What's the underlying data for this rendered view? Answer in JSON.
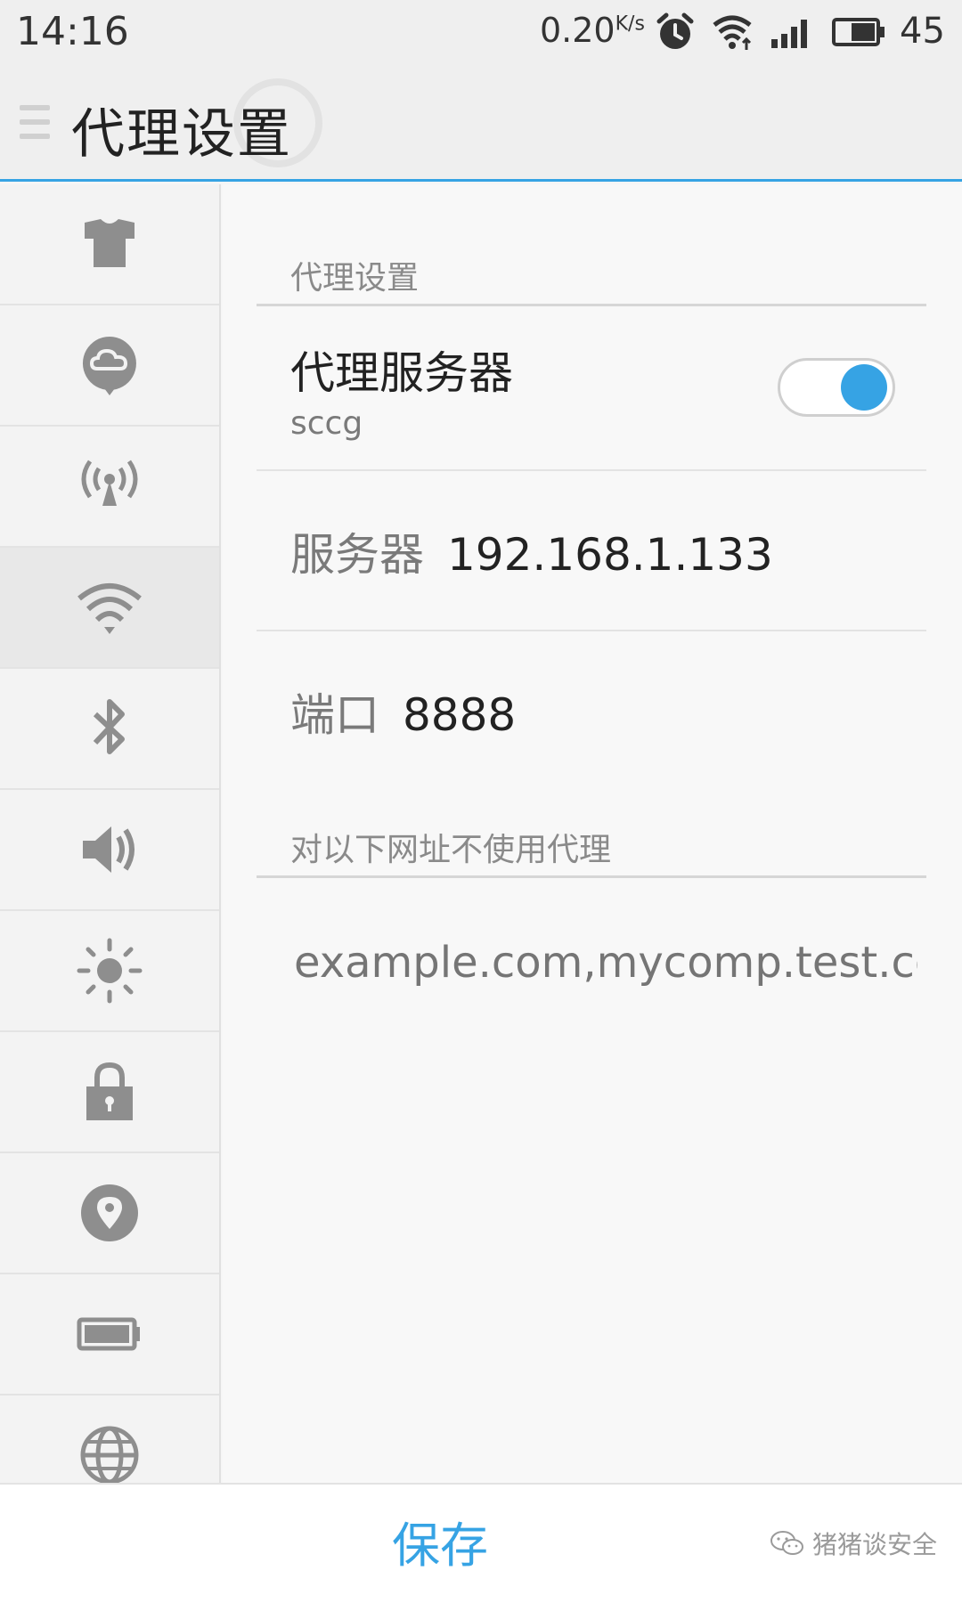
{
  "status_bar": {
    "time": "14:16",
    "speed_value": "0.20",
    "speed_unit": "K/s",
    "battery_level": "45"
  },
  "header": {
    "title": "代理设置",
    "menu_icon": "menu-icon"
  },
  "sidebar": {
    "items": [
      {
        "icon": "theme-shirt-icon",
        "active": false
      },
      {
        "icon": "cloud-bubble-icon",
        "active": false
      },
      {
        "icon": "hotspot-icon",
        "active": false
      },
      {
        "icon": "wifi-icon",
        "active": true
      },
      {
        "icon": "bluetooth-icon",
        "active": false
      },
      {
        "icon": "sound-icon",
        "active": false
      },
      {
        "icon": "brightness-icon",
        "active": false
      },
      {
        "icon": "lock-icon",
        "active": false
      },
      {
        "icon": "location-icon",
        "active": false
      },
      {
        "icon": "battery-icon",
        "active": false
      },
      {
        "icon": "globe-icon",
        "active": false
      }
    ]
  },
  "content": {
    "section_proxy": "代理设置",
    "proxy_server": {
      "title": "代理服务器",
      "subtitle": "sccg",
      "enabled": true
    },
    "server": {
      "label": "服务器",
      "value": "192.168.1.133"
    },
    "port": {
      "label": "端口",
      "value": "8888"
    },
    "section_bypass": "对以下网址不使用代理",
    "bypass_placeholder": "example.com,mycomp.test.co"
  },
  "bottom_bar": {
    "save_label": "保存",
    "watermark": "猪猪谈安全"
  },
  "colors": {
    "accent": "#36a3e4",
    "icon_gray": "#8e8e8e"
  }
}
